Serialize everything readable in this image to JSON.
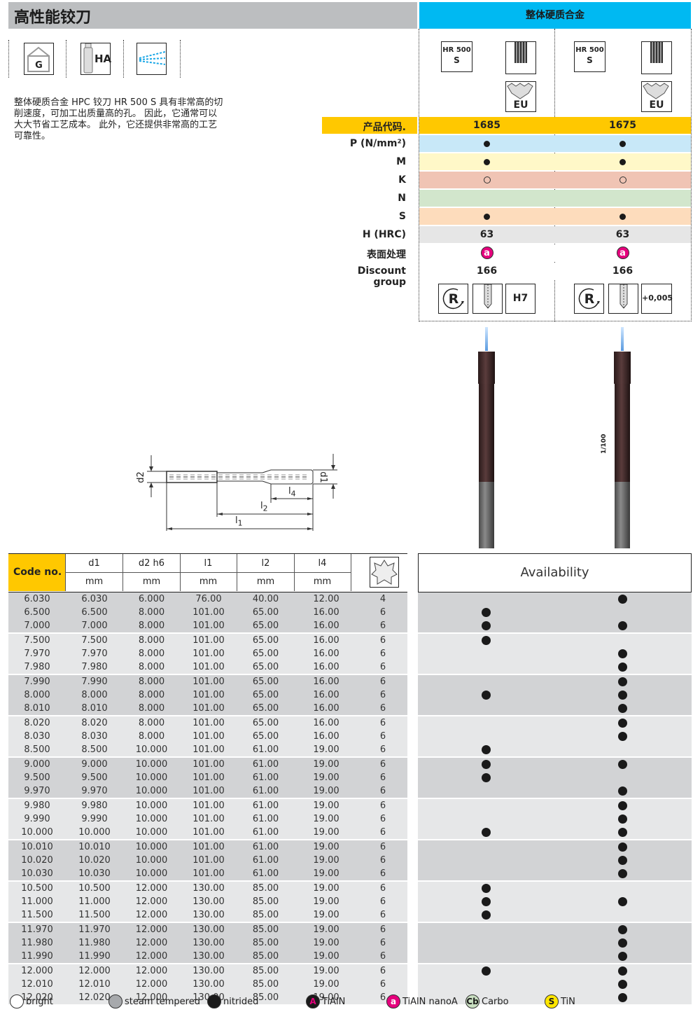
{
  "header": {
    "title": "高性能铰刀",
    "category": "整体硬质合金"
  },
  "feature_icons": [
    {
      "name": "g-tolerance-icon",
      "label": "G"
    },
    {
      "name": "ha-shank-icon",
      "label": "HA"
    },
    {
      "name": "coolant-icon",
      "label": ""
    }
  ],
  "description": "整体硬质合金 HPC 铰刀 HR 500 S 具有非常高的切削速度，可加工出质量高的孔。 因此，它通常可以大大节省工艺成本。 此外，它还提供非常高的工艺可靠性。",
  "products": [
    {
      "series_badge_line1": "HR 500",
      "series_badge_line2": "S",
      "eu_label": "EU",
      "code": "1685",
      "P": "filled",
      "M": "filled",
      "K": "open",
      "N": "",
      "S": "filled",
      "hrc": "63",
      "coating": "a",
      "discount_group": "166",
      "tolerance": "H7"
    },
    {
      "series_badge_line1": "HR 500",
      "series_badge_line2": "S",
      "eu_label": "EU",
      "code": "1675",
      "P": "filled",
      "M": "filled",
      "K": "open",
      "N": "",
      "S": "filled",
      "hrc": "63",
      "coating": "a",
      "discount_group": "166",
      "tolerance": "+0,005",
      "photo_note": "1/100"
    }
  ],
  "properties": {
    "code_label": "产品代码.",
    "rows": [
      {
        "key": "P",
        "label": "P (N/mm²)",
        "color": "#c8e8f8"
      },
      {
        "key": "M",
        "label": "M",
        "color": "#fff8c8"
      },
      {
        "key": "K",
        "label": "K",
        "color": "#f0c4b4"
      },
      {
        "key": "N",
        "label": "N",
        "color": "#d2e6cc"
      },
      {
        "key": "S",
        "label": "S",
        "color": "#fddcbc"
      },
      {
        "key": "hrc",
        "label": "H (HRC)",
        "color": "#e6e6e6"
      },
      {
        "key": "coating",
        "label": "表面处理",
        "color": "#ffffff"
      },
      {
        "key": "discount_group",
        "label": "Discount group",
        "color": "#ffffff"
      }
    ]
  },
  "drawing": {
    "d1": "d1",
    "d2": "d2",
    "l1": "l1",
    "l2": "l2",
    "l4": "l4"
  },
  "table": {
    "code_header": "Code no.",
    "columns": [
      {
        "name": "d1",
        "unit": "mm"
      },
      {
        "name": "d2 h6",
        "unit": "mm"
      },
      {
        "name": "l1",
        "unit": "mm"
      },
      {
        "name": "l2",
        "unit": "mm"
      },
      {
        "name": "l4",
        "unit": "mm"
      }
    ],
    "flutes_icon": "flutes-icon",
    "availability_header": "Availability",
    "rows": [
      {
        "code": "6.030",
        "d1": "6.030",
        "d2": "6.000",
        "l1": "76.00",
        "l2": "40.00",
        "l4": "12.00",
        "z": "4",
        "a1685": false,
        "a1675": true
      },
      {
        "code": "6.500",
        "d1": "6.500",
        "d2": "8.000",
        "l1": "101.00",
        "l2": "65.00",
        "l4": "16.00",
        "z": "6",
        "a1685": true,
        "a1675": false
      },
      {
        "code": "7.000",
        "d1": "7.000",
        "d2": "8.000",
        "l1": "101.00",
        "l2": "65.00",
        "l4": "16.00",
        "z": "6",
        "a1685": true,
        "a1675": true
      },
      {
        "code": "7.500",
        "d1": "7.500",
        "d2": "8.000",
        "l1": "101.00",
        "l2": "65.00",
        "l4": "16.00",
        "z": "6",
        "a1685": true,
        "a1675": false
      },
      {
        "code": "7.970",
        "d1": "7.970",
        "d2": "8.000",
        "l1": "101.00",
        "l2": "65.00",
        "l4": "16.00",
        "z": "6",
        "a1685": false,
        "a1675": true
      },
      {
        "code": "7.980",
        "d1": "7.980",
        "d2": "8.000",
        "l1": "101.00",
        "l2": "65.00",
        "l4": "16.00",
        "z": "6",
        "a1685": false,
        "a1675": true
      },
      {
        "code": "7.990",
        "d1": "7.990",
        "d2": "8.000",
        "l1": "101.00",
        "l2": "65.00",
        "l4": "16.00",
        "z": "6",
        "a1685": false,
        "a1675": true
      },
      {
        "code": "8.000",
        "d1": "8.000",
        "d2": "8.000",
        "l1": "101.00",
        "l2": "65.00",
        "l4": "16.00",
        "z": "6",
        "a1685": true,
        "a1675": true
      },
      {
        "code": "8.010",
        "d1": "8.010",
        "d2": "8.000",
        "l1": "101.00",
        "l2": "65.00",
        "l4": "16.00",
        "z": "6",
        "a1685": false,
        "a1675": true
      },
      {
        "code": "8.020",
        "d1": "8.020",
        "d2": "8.000",
        "l1": "101.00",
        "l2": "65.00",
        "l4": "16.00",
        "z": "6",
        "a1685": false,
        "a1675": true
      },
      {
        "code": "8.030",
        "d1": "8.030",
        "d2": "8.000",
        "l1": "101.00",
        "l2": "65.00",
        "l4": "16.00",
        "z": "6",
        "a1685": false,
        "a1675": true
      },
      {
        "code": "8.500",
        "d1": "8.500",
        "d2": "10.000",
        "l1": "101.00",
        "l2": "61.00",
        "l4": "19.00",
        "z": "6",
        "a1685": true,
        "a1675": false
      },
      {
        "code": "9.000",
        "d1": "9.000",
        "d2": "10.000",
        "l1": "101.00",
        "l2": "61.00",
        "l4": "19.00",
        "z": "6",
        "a1685": true,
        "a1675": true
      },
      {
        "code": "9.500",
        "d1": "9.500",
        "d2": "10.000",
        "l1": "101.00",
        "l2": "61.00",
        "l4": "19.00",
        "z": "6",
        "a1685": true,
        "a1675": false
      },
      {
        "code": "9.970",
        "d1": "9.970",
        "d2": "10.000",
        "l1": "101.00",
        "l2": "61.00",
        "l4": "19.00",
        "z": "6",
        "a1685": false,
        "a1675": true
      },
      {
        "code": "9.980",
        "d1": "9.980",
        "d2": "10.000",
        "l1": "101.00",
        "l2": "61.00",
        "l4": "19.00",
        "z": "6",
        "a1685": false,
        "a1675": true
      },
      {
        "code": "9.990",
        "d1": "9.990",
        "d2": "10.000",
        "l1": "101.00",
        "l2": "61.00",
        "l4": "19.00",
        "z": "6",
        "a1685": false,
        "a1675": true
      },
      {
        "code": "10.000",
        "d1": "10.000",
        "d2": "10.000",
        "l1": "101.00",
        "l2": "61.00",
        "l4": "19.00",
        "z": "6",
        "a1685": true,
        "a1675": true
      },
      {
        "code": "10.010",
        "d1": "10.010",
        "d2": "10.000",
        "l1": "101.00",
        "l2": "61.00",
        "l4": "19.00",
        "z": "6",
        "a1685": false,
        "a1675": true
      },
      {
        "code": "10.020",
        "d1": "10.020",
        "d2": "10.000",
        "l1": "101.00",
        "l2": "61.00",
        "l4": "19.00",
        "z": "6",
        "a1685": false,
        "a1675": true
      },
      {
        "code": "10.030",
        "d1": "10.030",
        "d2": "10.000",
        "l1": "101.00",
        "l2": "61.00",
        "l4": "19.00",
        "z": "6",
        "a1685": false,
        "a1675": true
      },
      {
        "code": "10.500",
        "d1": "10.500",
        "d2": "12.000",
        "l1": "130.00",
        "l2": "85.00",
        "l4": "19.00",
        "z": "6",
        "a1685": true,
        "a1675": false
      },
      {
        "code": "11.000",
        "d1": "11.000",
        "d2": "12.000",
        "l1": "130.00",
        "l2": "85.00",
        "l4": "19.00",
        "z": "6",
        "a1685": true,
        "a1675": true
      },
      {
        "code": "11.500",
        "d1": "11.500",
        "d2": "12.000",
        "l1": "130.00",
        "l2": "85.00",
        "l4": "19.00",
        "z": "6",
        "a1685": true,
        "a1675": false
      },
      {
        "code": "11.970",
        "d1": "11.970",
        "d2": "12.000",
        "l1": "130.00",
        "l2": "85.00",
        "l4": "19.00",
        "z": "6",
        "a1685": false,
        "a1675": true
      },
      {
        "code": "11.980",
        "d1": "11.980",
        "d2": "12.000",
        "l1": "130.00",
        "l2": "85.00",
        "l4": "19.00",
        "z": "6",
        "a1685": false,
        "a1675": true
      },
      {
        "code": "11.990",
        "d1": "11.990",
        "d2": "12.000",
        "l1": "130.00",
        "l2": "85.00",
        "l4": "19.00",
        "z": "6",
        "a1685": false,
        "a1675": true
      },
      {
        "code": "12.000",
        "d1": "12.000",
        "d2": "12.000",
        "l1": "130.00",
        "l2": "85.00",
        "l4": "19.00",
        "z": "6",
        "a1685": true,
        "a1675": true
      },
      {
        "code": "12.010",
        "d1": "12.010",
        "d2": "12.000",
        "l1": "130.00",
        "l2": "85.00",
        "l4": "19.00",
        "z": "6",
        "a1685": false,
        "a1675": true
      },
      {
        "code": "12.020",
        "d1": "12.020",
        "d2": "12.000",
        "l1": "130.00",
        "l2": "85.00",
        "l4": "19.00",
        "z": "6",
        "a1685": false,
        "a1675": true
      }
    ]
  },
  "legend": [
    {
      "key": "bright",
      "label": "bright",
      "symbol": "",
      "bg": "#ffffff",
      "fg": "#222222"
    },
    {
      "key": "steam",
      "label": "steam tempered",
      "symbol": "",
      "bg": "#a7a9ac",
      "fg": "#222222"
    },
    {
      "key": "nitrided",
      "label": "nitrided",
      "symbol": "",
      "bg": "#1a1a1a",
      "fg": "#ffffff"
    },
    {
      "key": "tialn",
      "label": "TiAlN",
      "symbol": "A",
      "bg": "#1a1a1a",
      "fg": "#e5007d"
    },
    {
      "key": "tialn-nano",
      "label": "TiAlN nanoA",
      "symbol": "a",
      "bg": "#e5007d",
      "fg": "#ffffff"
    },
    {
      "key": "carbo",
      "label": "Carbo",
      "symbol": "Cb",
      "bg": "#c9dfc1",
      "fg": "#1a1a1a"
    },
    {
      "key": "tin",
      "label": "TiN",
      "symbol": "S",
      "bg": "#ffe600",
      "fg": "#1a1a1a"
    }
  ],
  "colors": {
    "title_bg": "#bcbec0",
    "category_bg": "#00b9f2",
    "code_bg": "#ffc800",
    "row_group_dark": "#d2d3d5",
    "row_group_light": "#e6e7e8",
    "coating_pink": "#e5007d"
  }
}
